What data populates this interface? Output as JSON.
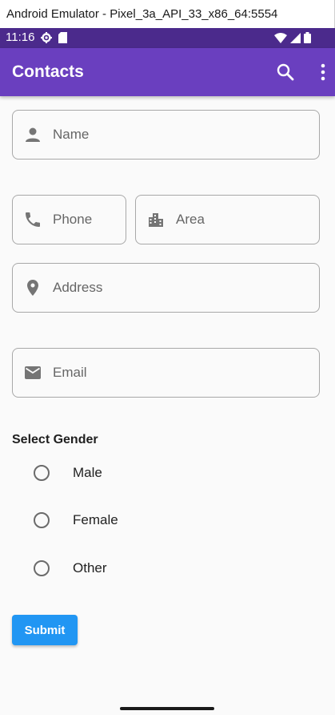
{
  "window": {
    "title": "Android Emulator - Pixel_3a_API_33_x86_64:5554"
  },
  "status_bar": {
    "time": "11:16",
    "icons_left": [
      "settings-icon",
      "sd-card-icon"
    ],
    "icons_right": [
      "wifi-icon",
      "signal-icon",
      "battery-icon"
    ],
    "color": "#4b2a8c"
  },
  "app_bar": {
    "title": "Contacts",
    "color": "#6a3fbf",
    "actions": [
      "search-icon",
      "more-vert-icon"
    ]
  },
  "form": {
    "name": {
      "placeholder": "Name",
      "icon": "person-icon"
    },
    "phone": {
      "placeholder": "Phone",
      "icon": "phone-icon"
    },
    "area": {
      "placeholder": "Area",
      "icon": "city-icon"
    },
    "address": {
      "placeholder": "Address",
      "icon": "location-pin-icon"
    },
    "email": {
      "placeholder": "Email",
      "icon": "email-icon"
    }
  },
  "gender": {
    "title": "Select Gender",
    "options": [
      "Male",
      "Female",
      "Other"
    ],
    "selected": null
  },
  "submit": {
    "label": "Submit",
    "color": "#2196f3"
  }
}
